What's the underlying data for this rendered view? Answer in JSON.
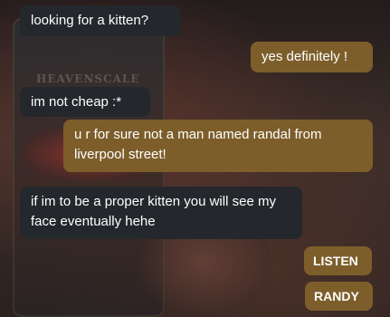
{
  "background": {
    "label": "HEAVENSCALE"
  },
  "messages": [
    {
      "sender": "them",
      "text": "looking for a kitten?"
    },
    {
      "sender": "me",
      "text": "yes definitely !"
    },
    {
      "sender": "them",
      "text": "im not cheap :*"
    },
    {
      "sender": "me",
      "text": "u r for sure not a man named randal from liverpool street!"
    },
    {
      "sender": "them",
      "text": "if im to be a proper kitten you will see my face eventually hehe"
    },
    {
      "sender": "me",
      "text": "LISTEN"
    },
    {
      "sender": "me",
      "text": "RANDY"
    }
  ],
  "colors": {
    "incoming_bubble": "#24272b",
    "outgoing_bubble": "#7d5e2b",
    "text": "#ffffff"
  }
}
